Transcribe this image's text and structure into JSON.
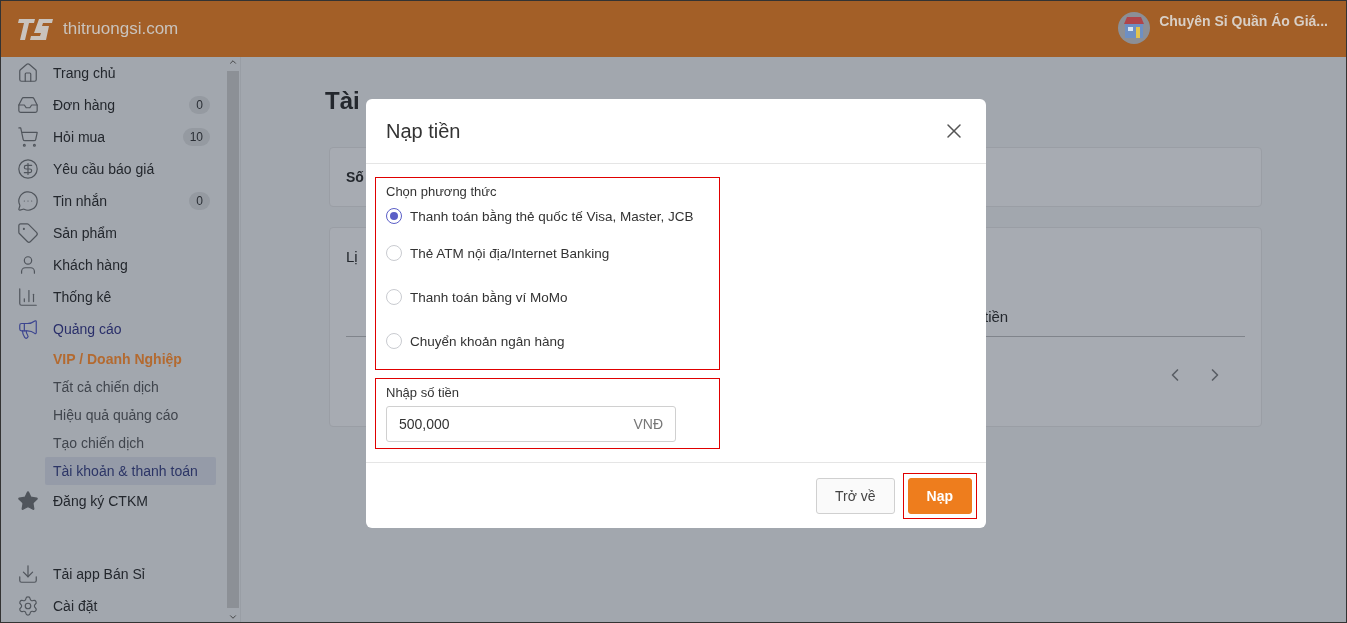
{
  "header": {
    "logo": "thitruongsi.com",
    "shop_name": "Chuyên Sỉ Quần Áo Giá..."
  },
  "sidebar": {
    "items": [
      {
        "label": "Trang chủ",
        "selected": false
      },
      {
        "label": "Đơn hàng",
        "badge": "0",
        "selected": false
      },
      {
        "label": "Hỏi mua",
        "badge": "10",
        "selected": false
      },
      {
        "label": "Yêu cầu báo giá",
        "selected": false
      },
      {
        "label": "Tin nhắn",
        "badge": "0",
        "selected": false
      },
      {
        "label": "Sản phẩm",
        "selected": false
      },
      {
        "label": "Khách hàng",
        "selected": false
      },
      {
        "label": "Thống kê",
        "selected": false
      },
      {
        "label": "Quảng cáo",
        "selected": true,
        "expanded": true,
        "children": [
          {
            "label": "VIP / Doanh Nghiệp",
            "kind": "promo",
            "selected": false
          },
          {
            "label": "Tất cả chiến dịch",
            "kind": "link",
            "selected": false
          },
          {
            "label": "Hiệu quả quảng cáo",
            "kind": "link",
            "selected": false
          },
          {
            "label": "Tạo chiến dịch",
            "kind": "link",
            "selected": false
          },
          {
            "label": "Tài khoản & thanh toán",
            "kind": "link",
            "selected": true
          }
        ]
      },
      {
        "label": "Đăng ký CTKM",
        "selected": false
      }
    ],
    "bottom_items": [
      {
        "label": "Tải app Bán Sỉ"
      },
      {
        "label": "Cài đặt"
      }
    ]
  },
  "page": {
    "title": "Tài",
    "balance_card": {
      "label": "Số"
    },
    "history_card": {
      "title": "Lị",
      "column": "tiền"
    }
  },
  "dialog": {
    "title": "Nạp tiền",
    "method_label": "Chọn phương thức",
    "methods": [
      {
        "label": "Thanh toán bằng thẻ quốc tế Visa, Master, JCB",
        "selected": true
      },
      {
        "label": "Thẻ ATM nội địa/Internet Banking",
        "selected": false
      },
      {
        "label": "Thanh toán bằng ví MoMo",
        "selected": false
      },
      {
        "label": "Chuyển khoản ngân hàng",
        "selected": false
      }
    ],
    "amount_label": "Nhập số tiền",
    "amount": {
      "value": "500,000",
      "unit": "VNĐ"
    },
    "buttons": [
      {
        "label": "Trở về",
        "kind": "secondary"
      },
      {
        "label": "Nạp",
        "kind": "primary"
      }
    ]
  }
}
